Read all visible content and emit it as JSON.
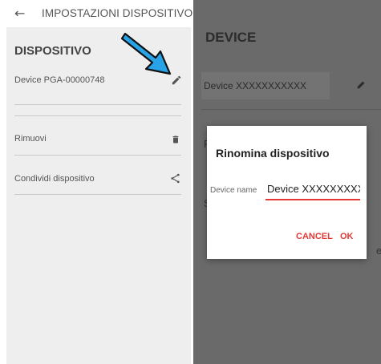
{
  "left_screen": {
    "topbar": {
      "back_icon": "arrow-back-icon",
      "title": "IMPOSTAZIONI DISPOSITIVO"
    },
    "section_title": "DISPOSITIVO",
    "device_name": "Device PGA-00000748",
    "rows": [
      {
        "label": "Rimuovi",
        "icon": "trash-icon"
      },
      {
        "label": "Condividi dispositivo",
        "icon": "share-icon"
      }
    ]
  },
  "right_screen": {
    "section_title": "DEVICE",
    "device_name": "Device XXXXXXXXXXX",
    "peek_letters": [
      "R",
      "S",
      "e"
    ]
  },
  "dialog": {
    "title": "Rinomina dispositivo",
    "field_label": "Device name",
    "field_value": "Device XXXXXXXXXXX",
    "cancel_label": "CANCEL",
    "ok_label": "OK"
  },
  "colors": {
    "accent": "#e53935",
    "overlay": "#6a6a6a",
    "panel_bg": "#eeeeee",
    "arrow": "#29a3e8"
  }
}
